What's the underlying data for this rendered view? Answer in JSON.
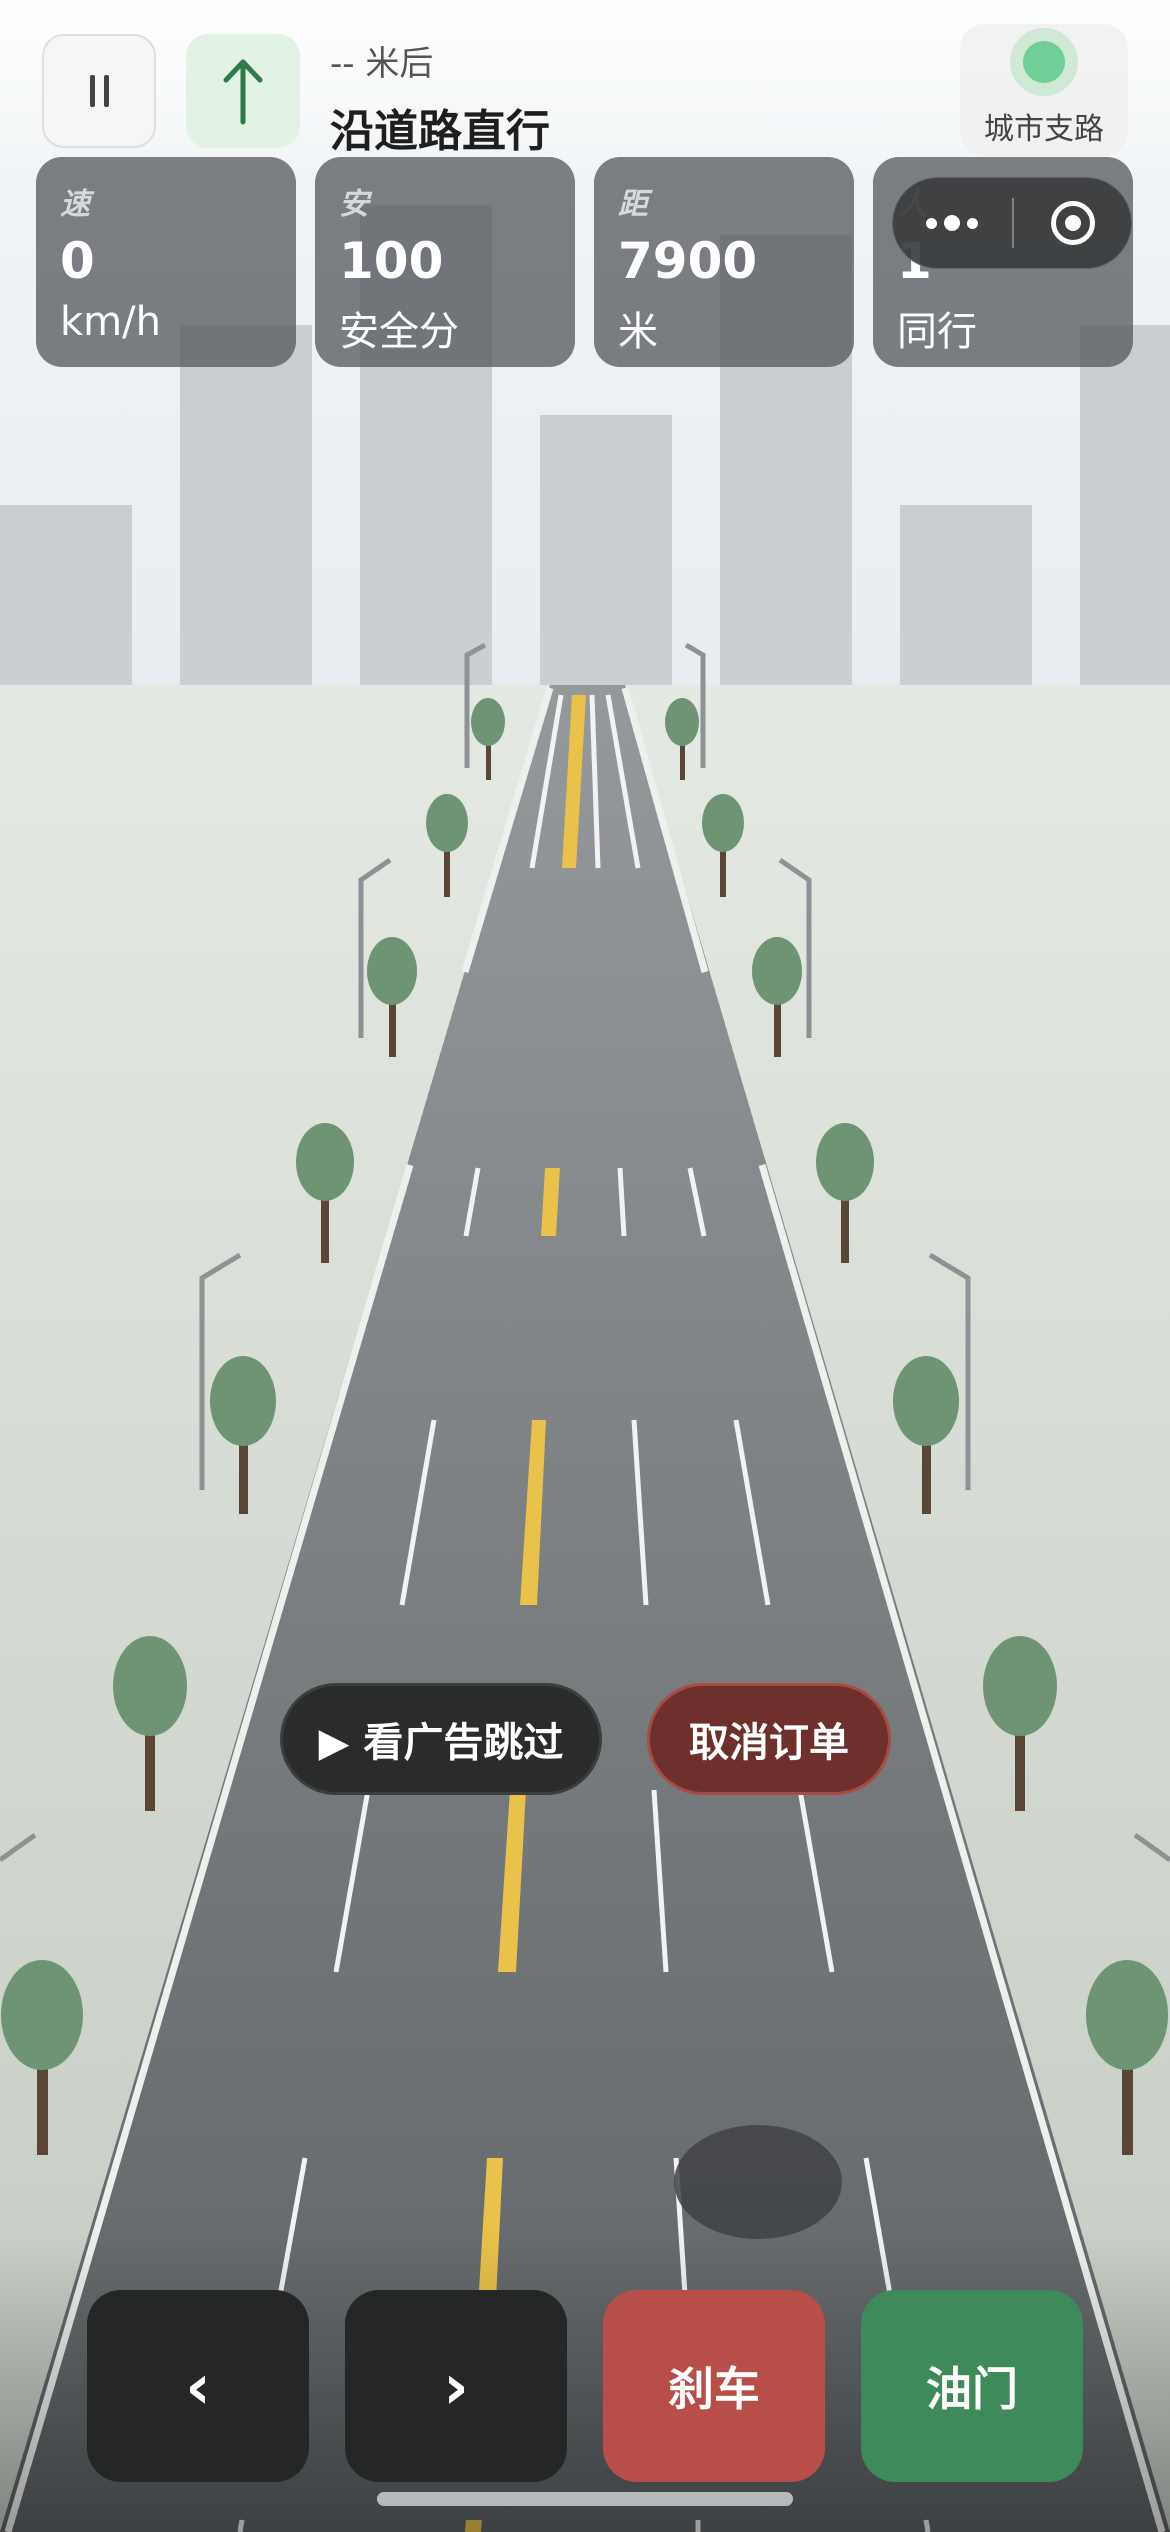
{
  "nav": {
    "pause_icon": "pause-icon",
    "direction_icon": "arrow-up-icon",
    "distance_text": "-- 米后",
    "instruction": "沿道路直行",
    "road_type": "城市支路",
    "road_dot_color": "#6fcf97"
  },
  "stats": [
    {
      "key": "速",
      "value": "0",
      "unit": "km/h"
    },
    {
      "key": "安",
      "value": "100",
      "unit": "安全分"
    },
    {
      "key": "距",
      "value": "7900",
      "unit": "米"
    },
    {
      "key": "人",
      "value": "1",
      "unit": "同行"
    }
  ],
  "capsule": {
    "more_icon": "more-dots-icon",
    "close_icon": "target-circle-icon"
  },
  "actions": {
    "ad_skip": "▶ 看广告跳过",
    "cancel_order": "取消订单"
  },
  "controls": {
    "left": "‹",
    "right": "›",
    "brake": "刹车",
    "throttle": "油门"
  },
  "colors": {
    "brake": "#b84e4a",
    "throttle": "#3f8a5a",
    "cancel": "#6e302d",
    "road": "#8a8d90",
    "center_line": "#e8c24a"
  }
}
